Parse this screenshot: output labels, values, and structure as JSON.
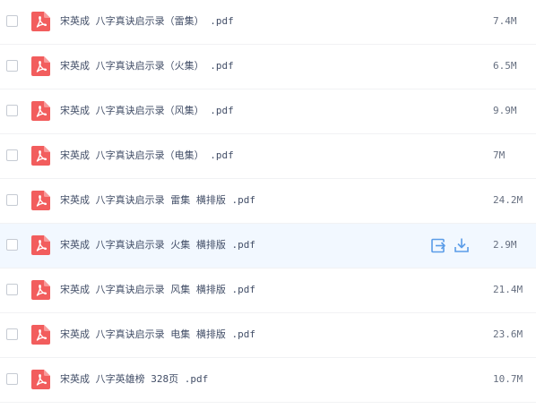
{
  "files": [
    {
      "name": "宋英成 八字真诀启示录（雷集） .pdf",
      "size": "7.4M"
    },
    {
      "name": "宋英成 八字真诀启示录（火集） .pdf",
      "size": "6.5M"
    },
    {
      "name": "宋英成 八字真诀启示录（风集） .pdf",
      "size": "9.9M"
    },
    {
      "name": "宋英成 八字真诀启示录（电集） .pdf",
      "size": "7M"
    },
    {
      "name": "宋英成 八字真诀启示录 雷集 横排版 .pdf",
      "size": "24.2M"
    },
    {
      "name": "宋英成 八字真诀启示录 火集 横排版 .pdf",
      "size": "2.9M"
    },
    {
      "name": "宋英成 八字真诀启示录 风集 横排版 .pdf",
      "size": "21.4M"
    },
    {
      "name": "宋英成 八字真诀启示录 电集 横排版 .pdf",
      "size": "23.6M"
    },
    {
      "name": "宋英成 八字英雄榜 328页 .pdf",
      "size": "10.7M"
    }
  ],
  "file_icon": "pdf-file-icon",
  "hovered_row_actions": [
    "share-icon",
    "download-icon"
  ],
  "colors": {
    "pdf_icon": "#f25d5d",
    "action_icon": "#5a9ce8",
    "hover_row_background": "#f2f8ff",
    "file_name_text": "#424e67",
    "file_size_text": "#666f80"
  }
}
